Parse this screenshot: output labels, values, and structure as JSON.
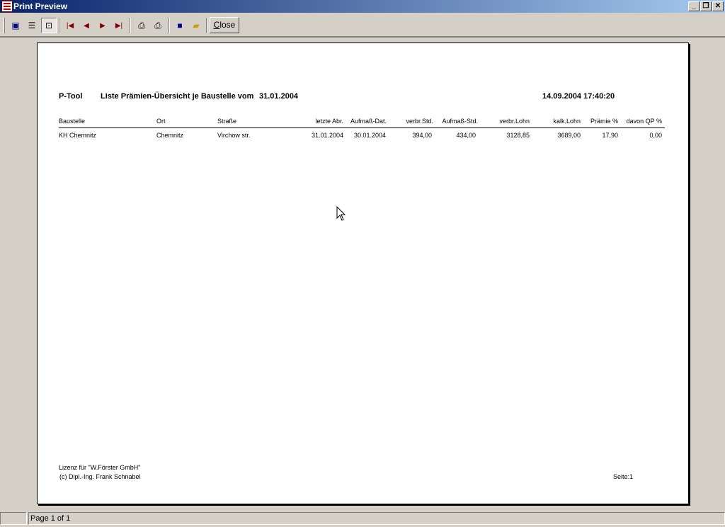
{
  "window": {
    "title": "Print Preview"
  },
  "toolbar": {
    "buttons": [
      {
        "icon": "one-page-icon",
        "glyph": "▣"
      },
      {
        "icon": "two-pages-icon",
        "glyph": "☰"
      },
      {
        "icon": "zoom-icon",
        "glyph": "⊡"
      },
      {
        "icon": "first-page-icon",
        "glyph": "⏮"
      },
      {
        "icon": "previous-page-icon",
        "glyph": "◀"
      },
      {
        "icon": "next-page-icon",
        "glyph": "▶"
      },
      {
        "icon": "last-page-icon",
        "glyph": "⏭"
      },
      {
        "icon": "print-setup-icon",
        "glyph": "⎙"
      },
      {
        "icon": "print-icon",
        "glyph": "🖶"
      },
      {
        "icon": "save-icon",
        "glyph": "💾"
      },
      {
        "icon": "open-icon",
        "glyph": "📂"
      }
    ],
    "close_label_underlined": "C",
    "close_label_rest": "lose"
  },
  "report": {
    "app_name": "P-Tool",
    "title": "Liste Prämien-Übersicht je Baustelle vom",
    "date": "31.01.2004",
    "timestamp": "14.09.2004 17:40:20",
    "columns": {
      "baustelle": "Baustelle",
      "ort": "Ort",
      "strasse": "Straße",
      "letzte_abr": "letzte Abr.",
      "aufmass_dat": "Aufmaß-Dat.",
      "verbr_std": "verbr.Std.",
      "aufmass_std": "Aufmaß-Std.",
      "verbr_lohn": "verbr.Lohn",
      "kalk_lohn": "kalk.Lohn",
      "praemie": "Prämie %",
      "davon_qp": "davon QP %"
    },
    "rows": [
      {
        "baustelle": "KH Chemnitz",
        "ort": "Chemnitz",
        "strasse": "Virchow str.",
        "letzte_abr": "31.01.2004",
        "aufmass_dat": "30.01.2004",
        "verbr_std": "394,00",
        "aufmass_std": "434,00",
        "verbr_lohn": "3128,85",
        "kalk_lohn": "3689,00",
        "praemie": "17,90",
        "davon_qp": "0,00"
      }
    ],
    "footer": {
      "license": "Lizenz für \"W.Förster GmbH\"",
      "copyright": "(c) Dipl.-Ing. Frank Schnabel",
      "page": "Seite:1"
    }
  },
  "status": {
    "page_text": "Page 1 of 1"
  }
}
